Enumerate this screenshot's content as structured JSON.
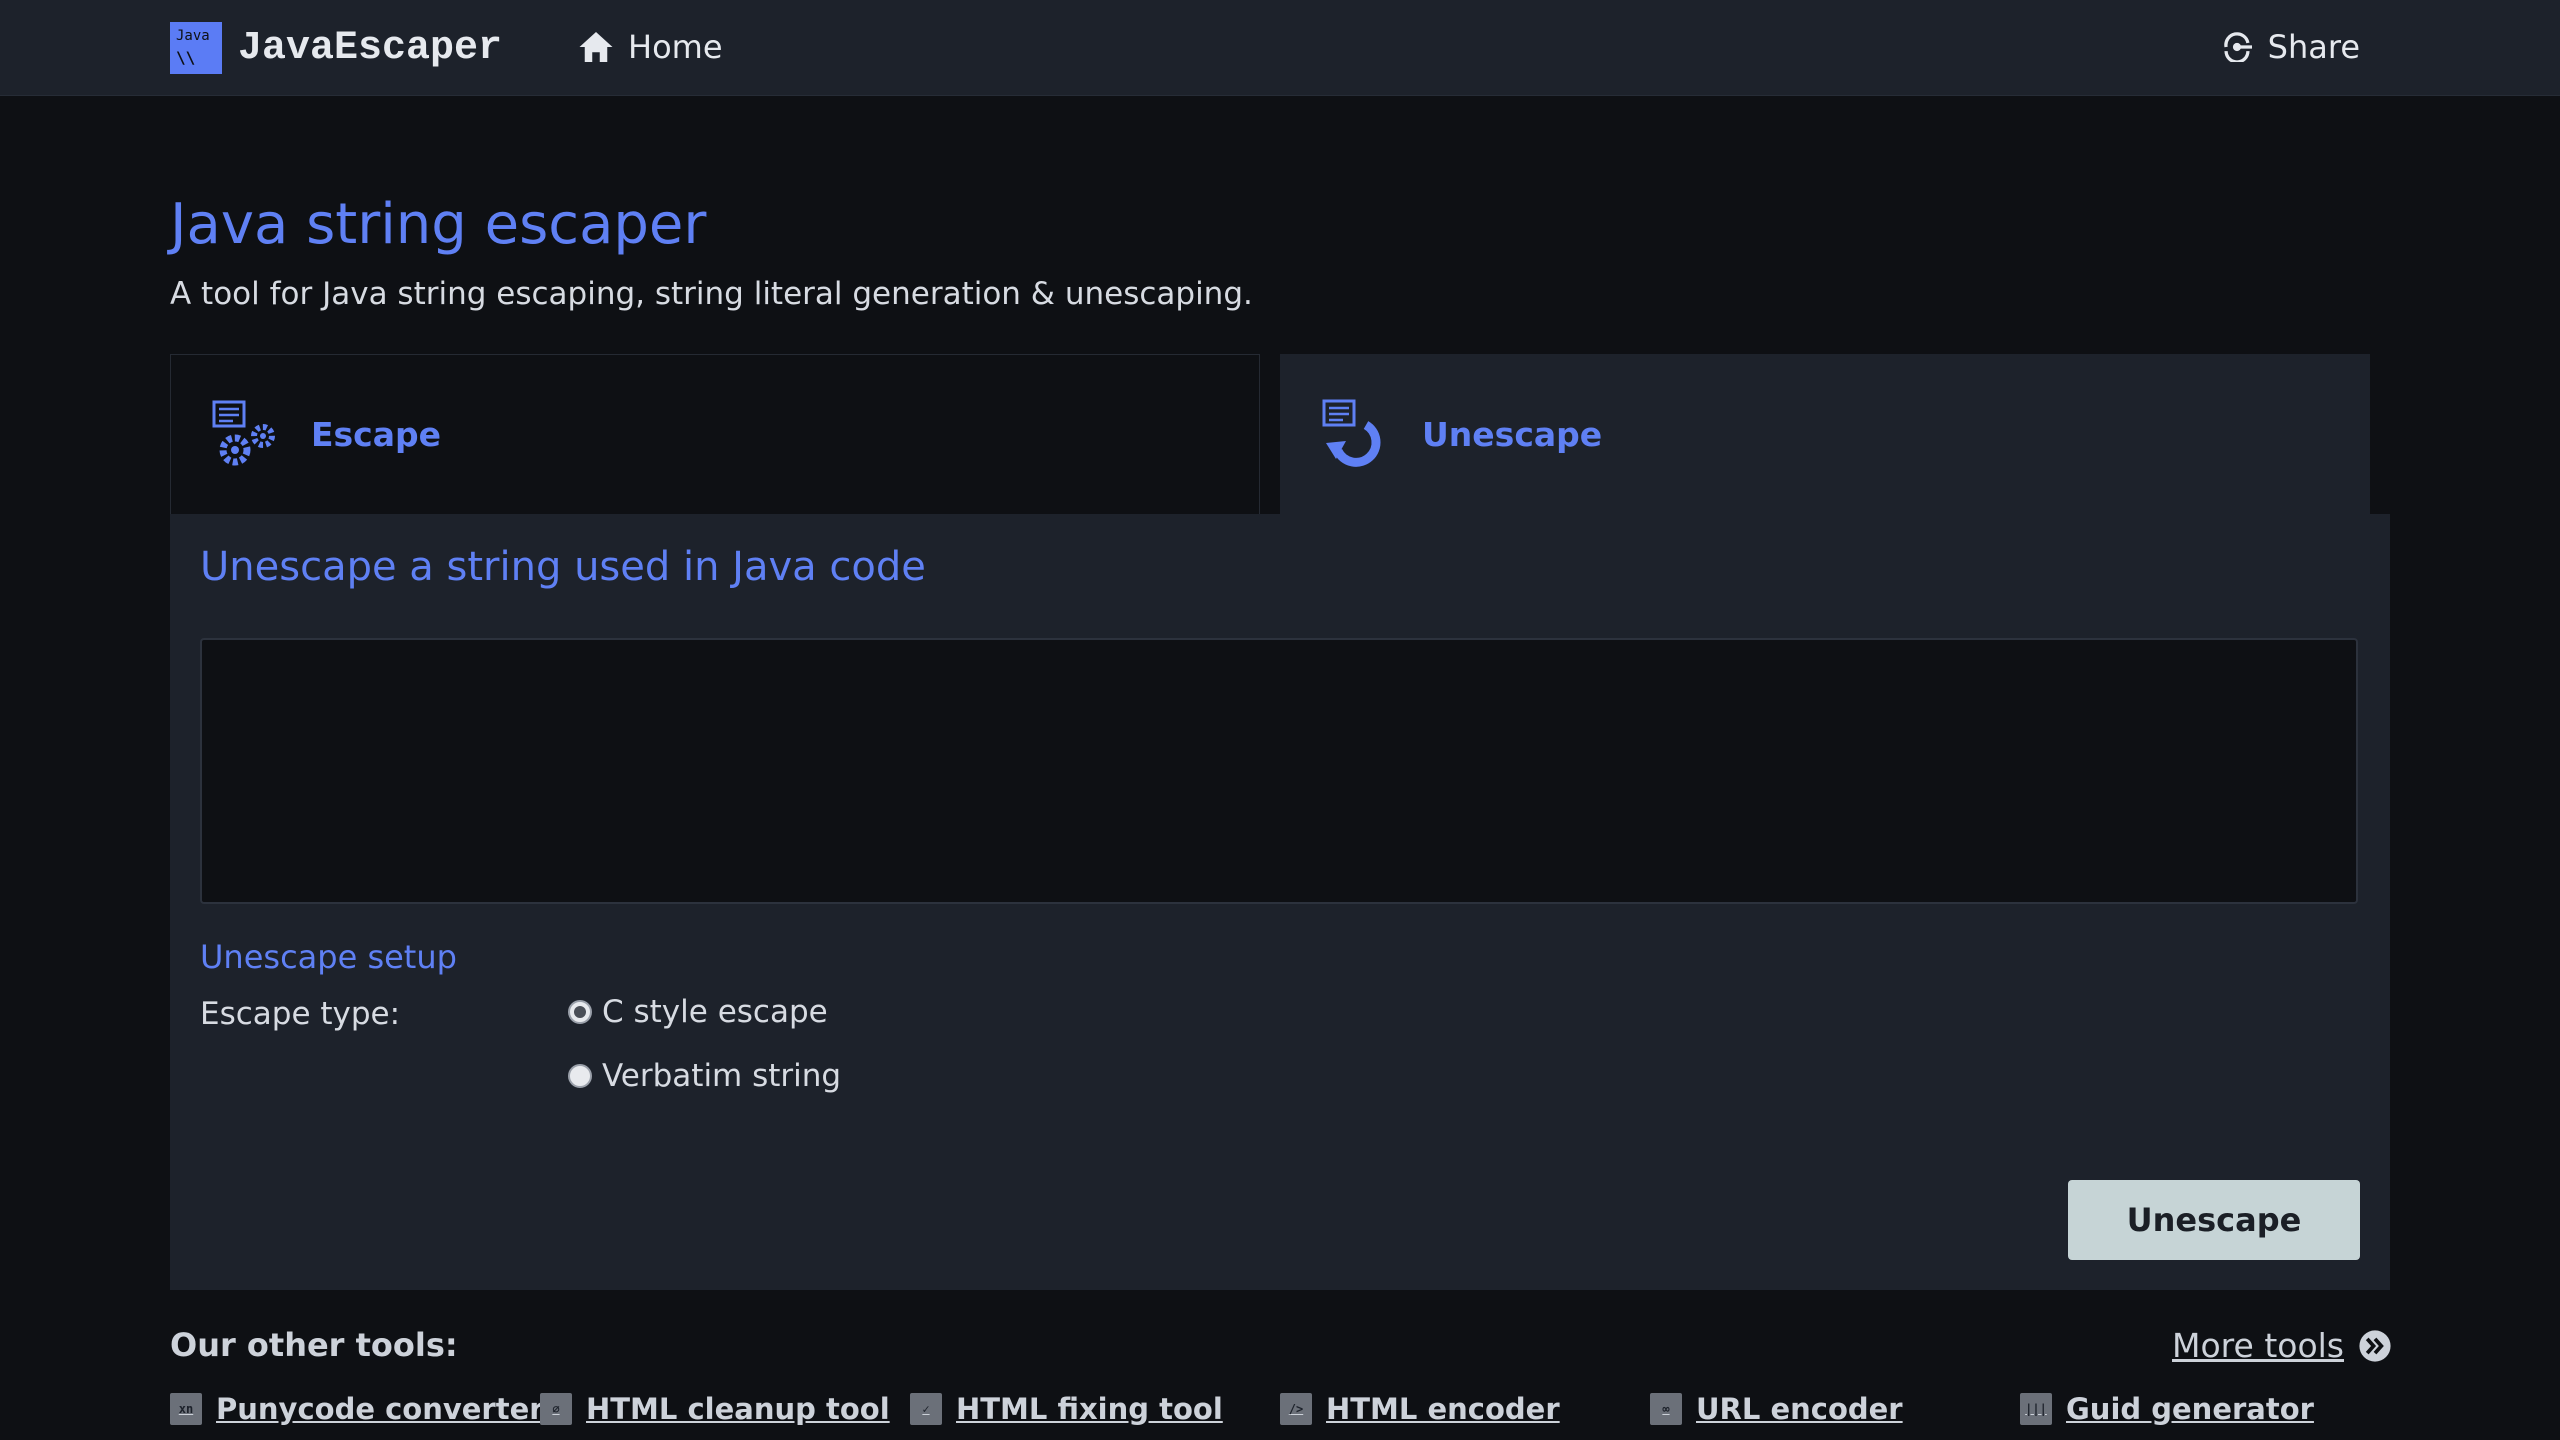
{
  "header": {
    "logo_line1": "Java",
    "logo_line2": "\\\\",
    "brand_name": "JavaEscaper",
    "home_label": "Home",
    "share_label": "Share"
  },
  "page": {
    "title": "Java string escaper",
    "subtitle": "A tool for Java string escaping, string literal generation & unescaping."
  },
  "tabs": [
    {
      "label": "Escape",
      "active": false
    },
    {
      "label": "Unescape",
      "active": true
    }
  ],
  "panel": {
    "title": "Unescape a string used in Java code",
    "input_value": "",
    "setup_title": "Unescape setup",
    "escape_type_label": "Escape type:",
    "options": [
      {
        "label": "C style escape",
        "checked": true
      },
      {
        "label": "Verbatim string",
        "checked": false
      }
    ],
    "button_label": "Unescape"
  },
  "other_tools": {
    "title": "Our other tools:",
    "more_label": "More tools",
    "items": [
      {
        "label": "Punycode converter",
        "icon": "punycode-icon",
        "glyph": "xn"
      },
      {
        "label": "HTML cleanup tool",
        "icon": "html-cleanup-icon",
        "glyph": "⌀"
      },
      {
        "label": "HTML fixing tool",
        "icon": "html-fixing-icon",
        "glyph": "✓"
      },
      {
        "label": "HTML encoder",
        "icon": "html-encoder-icon",
        "glyph": "/>"
      },
      {
        "label": "URL encoder",
        "icon": "url-encoder-icon",
        "glyph": "∞"
      },
      {
        "label": "Guid generator",
        "icon": "guid-generator-icon",
        "glyph": "|||"
      }
    ]
  },
  "colors": {
    "accent": "#5f80f4",
    "header_bg": "#1d222b",
    "page_bg": "#0e1014",
    "button_bg": "#c6d4d6"
  }
}
